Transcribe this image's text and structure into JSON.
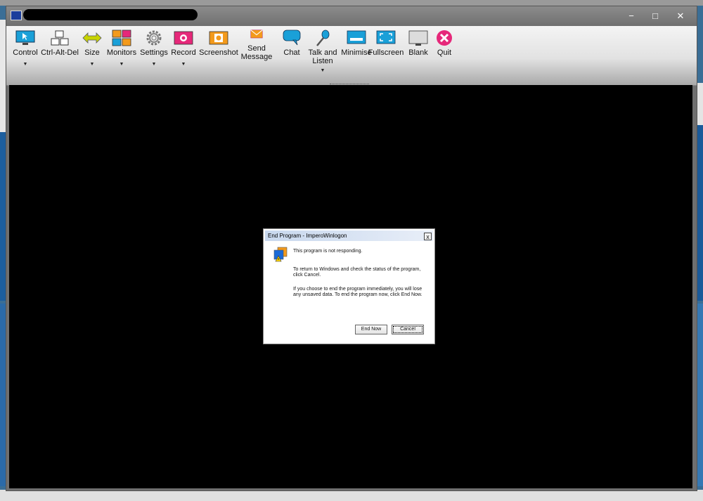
{
  "window": {
    "controls": {
      "minimize": "−",
      "maximize": "□",
      "close": "✕"
    }
  },
  "toolbar": {
    "items": [
      {
        "label": "Control",
        "icon": "monitor-cursor-icon",
        "dropdown": true
      },
      {
        "label": "Ctrl-Alt-Del",
        "icon": "keys-icon",
        "dropdown": false
      },
      {
        "label": "Size",
        "icon": "resize-arrows-icon",
        "dropdown": true
      },
      {
        "label": "Monitors",
        "icon": "monitors-grid-icon",
        "dropdown": true
      },
      {
        "label": "Settings",
        "icon": "gear-icon",
        "dropdown": true
      },
      {
        "label": "Record",
        "icon": "record-icon",
        "dropdown": true
      },
      {
        "label": "Screenshot",
        "icon": "camera-icon",
        "dropdown": false
      },
      {
        "label": "Send Message",
        "icon": "envelope-icon",
        "dropdown": false
      },
      {
        "label": "Chat",
        "icon": "chat-bubble-icon",
        "dropdown": false
      },
      {
        "label": "Talk and Listen",
        "icon": "microphone-icon",
        "dropdown": true
      },
      {
        "label": "Minimise",
        "icon": "minimise-screen-icon",
        "dropdown": false
      },
      {
        "label": "Fullscreen",
        "icon": "fullscreen-icon",
        "dropdown": false
      },
      {
        "label": "Blank",
        "icon": "blank-screen-icon",
        "dropdown": false
      },
      {
        "label": "Quit",
        "icon": "quit-x-icon",
        "dropdown": false
      }
    ]
  },
  "dialog": {
    "title": "End Program - ImperoWinlogon",
    "close": "x",
    "message1": "This program is not responding.",
    "message2": "To return to Windows and check the status of the program, click Cancel.",
    "message3": "If you choose to end the program immediately, you will lose any unsaved data. To end the program now, click End Now.",
    "end_now": "End Now",
    "cancel": "Cancel"
  }
}
